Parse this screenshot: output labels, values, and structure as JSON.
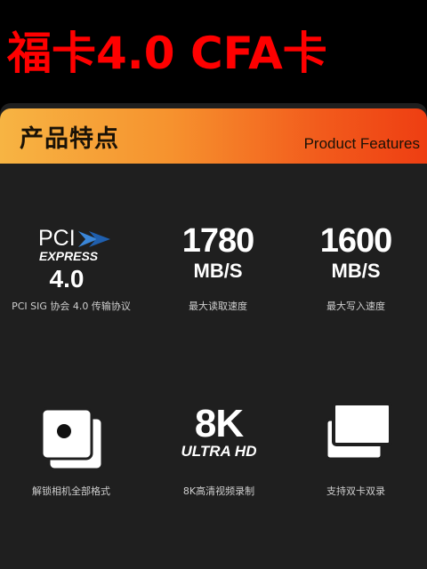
{
  "header": {
    "title": "福卡4.0 CFA卡",
    "title_color": "#ff0000"
  },
  "section": {
    "title": "产品特点",
    "subtitle": "Product Features",
    "band_colors": [
      "#f7b443",
      "#ee3e12"
    ]
  },
  "features": [
    {
      "icon": "pci-express-logo",
      "logo_word": "PCI",
      "logo_express": "EXPRESS",
      "value": "4.0",
      "label": "PCI SIG 协会 4.0 传输协议"
    },
    {
      "icon": "read-speed",
      "value": "1780",
      "unit": "MB/S",
      "label": "最大读取速度"
    },
    {
      "icon": "write-speed",
      "value": "1600",
      "unit": "MB/S",
      "label": "最大写入速度"
    },
    {
      "icon": "camera-format-icon",
      "label": "解锁相机全部格式"
    },
    {
      "icon": "8k-ultra-hd",
      "value": "8K",
      "unit": "ULTRA HD",
      "label": "8K高清视频录制"
    },
    {
      "icon": "dual-card-icon",
      "label": "支持双卡双录"
    }
  ]
}
